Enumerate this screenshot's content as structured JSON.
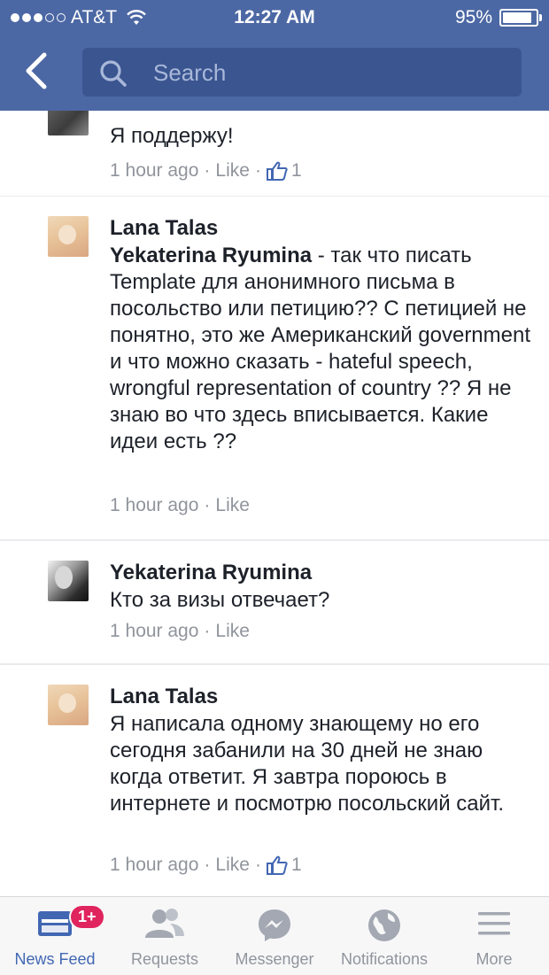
{
  "status": {
    "carrier": "AT&T",
    "time": "12:27 AM",
    "battery": "95%",
    "battery_level": 0.95
  },
  "header": {
    "back_icon": "chevron-left-icon",
    "search_placeholder": "Search"
  },
  "comments": [
    {
      "author": "",
      "text": "Я поддержу!",
      "time": "1 hour ago",
      "like": "Like",
      "likes": "1"
    },
    {
      "author": "Lana Talas",
      "mention": "Yekaterina Ryumina",
      "text": " - так что писать Template для анонимного письма в посольство или петицию?? С петицией не понятно, это же Американский government и что можно сказать - hateful speech, wrongful representation of country ?? Я не знаю во что здесь вписывается. Какие идеи есть ??",
      "time": "1 hour ago",
      "like": "Like"
    },
    {
      "author": "Yekaterina Ryumina",
      "text": "Кто за визы отвечает?",
      "time": "1 hour ago",
      "like": "Like"
    },
    {
      "author": "Lana Talas",
      "text": "Я написала одному знающему но его сегодня забанили на 30 дней не знаю когда ответит. Я завтра пороюсь в интернете и посмотрю посольский сайт.",
      "time": "1 hour ago",
      "like": "Like",
      "likes": "1"
    }
  ],
  "tabbar": {
    "tabs": [
      {
        "label": "News Feed",
        "icon": "news-feed-icon",
        "badge": "1+",
        "active": true
      },
      {
        "label": "Requests",
        "icon": "friends-icon"
      },
      {
        "label": "Messenger",
        "icon": "messenger-icon"
      },
      {
        "label": "Notifications",
        "icon": "globe-icon"
      },
      {
        "label": "More",
        "icon": "menu-icon"
      }
    ]
  },
  "colors": {
    "header_bg": "#4c68a4",
    "search_bg": "#3a5590",
    "active_tab": "#4267b2",
    "meta_text": "#90949c",
    "badge": "#e0245e"
  }
}
